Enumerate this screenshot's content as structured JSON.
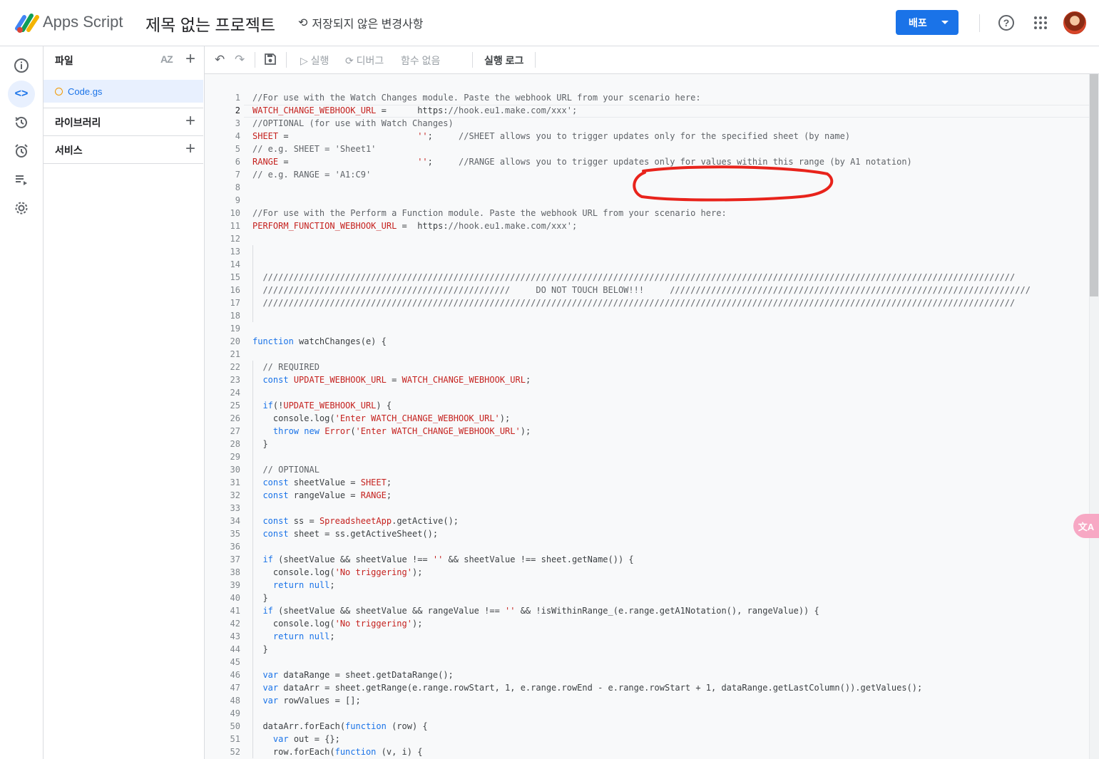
{
  "header": {
    "app_name": "Apps Script",
    "project_title": "제목 없는 프로젝트",
    "save_status": "저장되지 않은 변경사항",
    "deploy_label": "배포"
  },
  "rail": {
    "items": [
      "info-icon",
      "code-icon",
      "history-icon",
      "alarm-icon",
      "run-list-icon",
      "gear-icon"
    ]
  },
  "files_panel": {
    "title": "파일",
    "sort_label": "AZ",
    "files": [
      {
        "name": "Code.gs"
      }
    ],
    "libraries_label": "라이브러리",
    "services_label": "서비스"
  },
  "toolbar": {
    "run_label": "실행",
    "debug_label": "디버그",
    "function_label": "함수 없음",
    "log_label": "실행 로그"
  },
  "editor": {
    "current_line": 2,
    "code_text": [
      "//For use with the Watch Changes module. Paste the webhook URL from your scenario here:",
      "WATCH_CHANGE_WEBHOOK_URL =      'https://hook.eu1.make.com/xxx';",
      "//OPTIONAL (for use with Watch Changes)",
      "SHEET =                         '';     //SHEET allows you to trigger updates only for the specified sheet (by name)",
      "// e.g. SHEET = 'Sheet1'",
      "RANGE =                         '';     //RANGE allows you to trigger updates only for values within this range (by A1 notation)",
      "// e.g. RANGE = 'A1:C9'",
      "",
      "",
      "//For use with the Perform a Function module. Paste the webhook URL from your scenario here:",
      "PERFORM_FUNCTION_WEBHOOK_URL =  'https://hook.eu1.make.com/xxx';",
      "",
      "",
      "",
      "  //////////////////////////////////////////////////////////////////////////////////////////////////////////////////////////////////////////////////",
      "  ////////////////////////////////////////////////     DO NOT TOUCH BELOW!!!     //////////////////////////////////////////////////////////////////////",
      "  //////////////////////////////////////////////////////////////////////////////////////////////////////////////////////////////////////////////////",
      "",
      "",
      "function watchChanges(e) {",
      "",
      "  // REQUIRED",
      "  const UPDATE_WEBHOOK_URL = WATCH_CHANGE_WEBHOOK_URL;",
      "",
      "  if(!UPDATE_WEBHOOK_URL) {",
      "    console.log('Enter WATCH_CHANGE_WEBHOOK_URL');",
      "    throw new Error('Enter WATCH_CHANGE_WEBHOOK_URL');",
      "  }",
      "",
      "  // OPTIONAL",
      "  const sheetValue = SHEET;",
      "  const rangeValue = RANGE;",
      "",
      "  const ss = SpreadsheetApp.getActive();",
      "  const sheet = ss.getActiveSheet();",
      "",
      "  if (sheetValue && sheetValue !== '' && sheetValue !== sheet.getName()) {",
      "    console.log('No triggering');",
      "    return null;",
      "  }",
      "  if (sheetValue && sheetValue && rangeValue !== '' && !isWithinRange_(e.range.getA1Notation(), rangeValue)) {",
      "    console.log('No triggering');",
      "    return null;",
      "  }",
      "",
      "  var dataRange = sheet.getDataRange();",
      "  var dataArr = sheet.getRange(e.range.rowStart, 1, e.range.rowEnd - e.range.rowStart + 1, dataRange.getLastColumn()).getValues();",
      "  var rowValues = [];",
      "",
      "  dataArr.forEach(function (row) {",
      "    var out = {};",
      "    row.forEach(function (v, i) {"
    ]
  },
  "colors": {
    "accent": "#1a73e8",
    "keyword": "#1a73e8",
    "string": "#c5221f",
    "comment": "#5f6368",
    "annotation": "#e8231b"
  },
  "overlay": {
    "translate_label": "번역"
  }
}
